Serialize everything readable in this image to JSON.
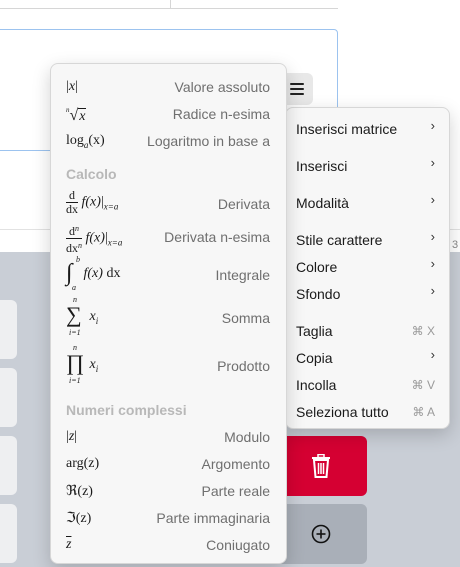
{
  "functions_menu": {
    "items_top": [
      {
        "label": "Valore assoluto",
        "math": "|x|"
      },
      {
        "label": "Radice n-esima",
        "math": "ⁿ√x"
      },
      {
        "label": "Logaritmo in base a",
        "math": "log_a(x)"
      }
    ],
    "section_calcolo": "Calcolo",
    "items_calcolo": [
      {
        "label": "Derivata",
        "math": "d/dx f(x)|x=a"
      },
      {
        "label": "Derivata n-esima",
        "math": "dⁿ/dxⁿ f(x)|x=a"
      },
      {
        "label": "Integrale",
        "math": "∫ₐᵇ f(x) dx"
      },
      {
        "label": "Somma",
        "math": "∑ xᵢ"
      },
      {
        "label": "Prodotto",
        "math": "∏ xᵢ"
      }
    ],
    "section_complessi": "Numeri complessi",
    "items_complessi": [
      {
        "label": "Modulo",
        "math": "|z|"
      },
      {
        "label": "Argomento",
        "math": "arg(z)"
      },
      {
        "label": "Parte reale",
        "math": "ℜ(z)"
      },
      {
        "label": "Parte immaginaria",
        "math": "ℑ(z)"
      },
      {
        "label": "Coniugato",
        "math": "z̄"
      }
    ]
  },
  "math_text": {
    "x": "x",
    "z": "z",
    "a": "a",
    "b": "b",
    "n": "n",
    "i": "i",
    "i_eq_1": "i=1",
    "x_eq_a": "x=a",
    "f_of_x": "f(x)",
    "log": "log",
    "arg": "arg",
    "d": "d",
    "dx": "dx",
    "dn": "d",
    "dxn": "dx",
    "sum": "∑",
    "prod": "∏",
    "integral": "∫",
    "sqrt": "√",
    "re": "ℜ",
    "im": "ℑ",
    "paren_z": "(z)",
    "paren_x": "(x)"
  },
  "main_menu": {
    "items": [
      {
        "label": "Inserisci matrice",
        "chevron": "›"
      },
      {
        "label": "Inserisci",
        "chevron": "›"
      },
      {
        "label": "Modalità",
        "chevron": "›"
      },
      {
        "label": "Stile carattere",
        "chevron": "›"
      },
      {
        "label": "Colore",
        "chevron": "›"
      },
      {
        "label": "Sfondo",
        "chevron": "›"
      },
      {
        "label": "Taglia",
        "shortcut": "⌘ X"
      },
      {
        "label": "Copia",
        "chevron": "›"
      },
      {
        "label": "Incolla",
        "shortcut": "⌘ V"
      },
      {
        "label": "Seleziona tutto",
        "shortcut": "⌘ A"
      }
    ]
  },
  "background": {
    "edge_digit": "3",
    "icons": [
      "hamburger-icon",
      "trash-icon",
      "plus-circle-icon"
    ]
  },
  "colors": {
    "delete_key": "#d50032",
    "keypad_bg": "#c9ced6",
    "menu_bg": "#f7f7f7",
    "input_border": "#9cc3ef"
  }
}
